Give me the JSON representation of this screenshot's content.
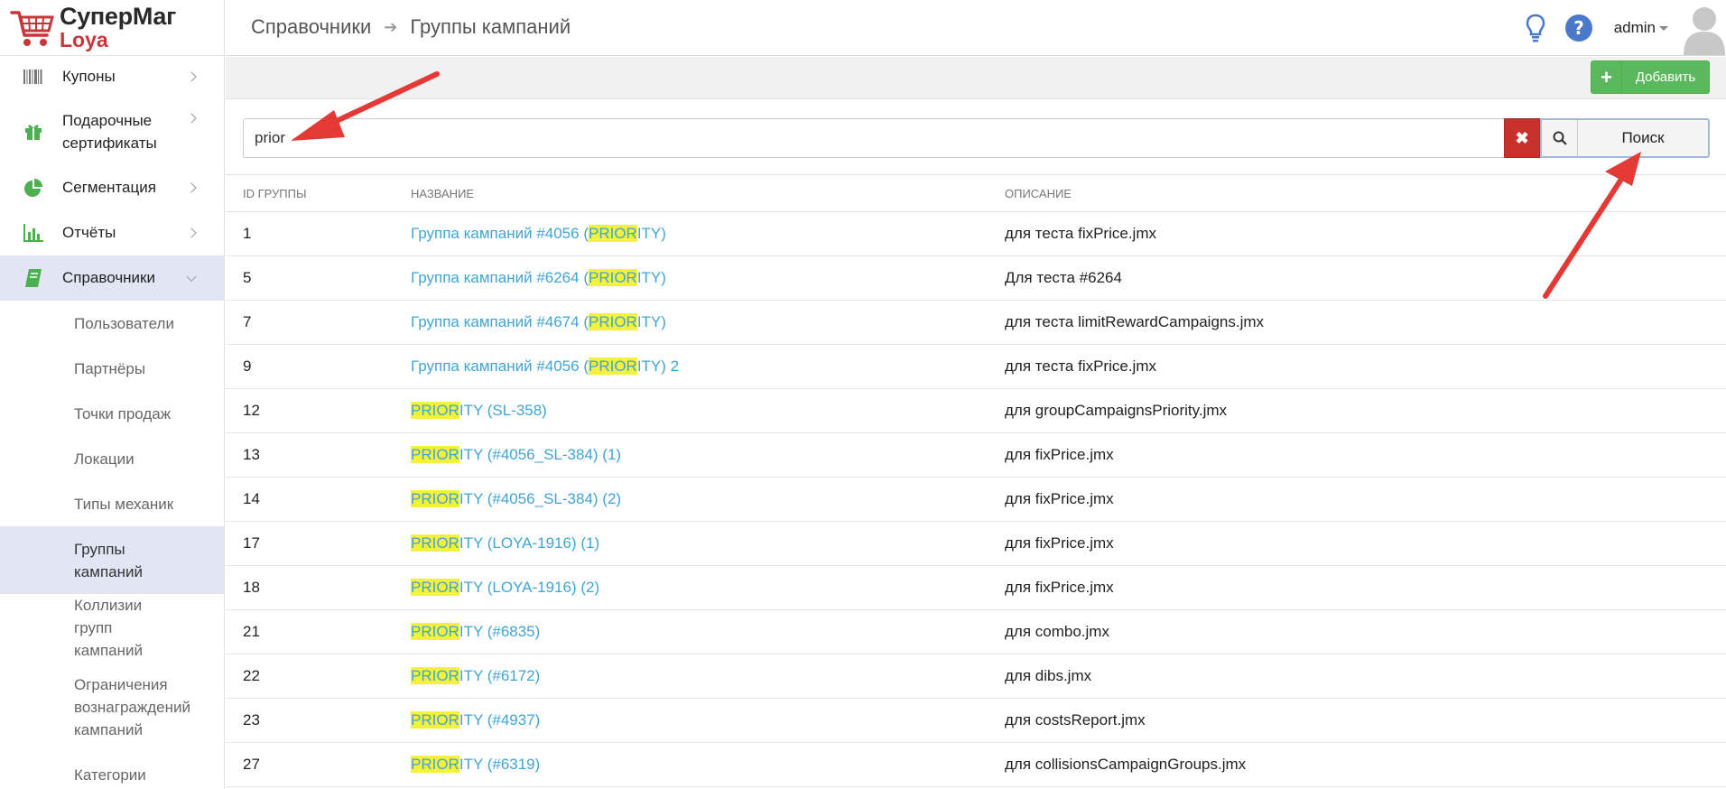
{
  "logo": {
    "line1": "СуперМаг",
    "line2": "Loya"
  },
  "colors": {
    "accent": "#3fa5d6",
    "brand_red": "#c8363a",
    "highlight": "#f5f23a",
    "add_green": "#5cb85c",
    "clear_red": "#c9302c",
    "active_bg": "#e2e6f4",
    "arrow_red": "#e53935"
  },
  "sidebar": {
    "items": [
      {
        "label": "Купоны",
        "icon": "barcode-icon"
      },
      {
        "label": "Подарочные\nсертификаты",
        "icon": "gift-icon"
      },
      {
        "label": "Сегментация",
        "icon": "pie-chart-icon"
      },
      {
        "label": "Отчёты",
        "icon": "bar-chart-icon"
      },
      {
        "label": "Справочники",
        "icon": "book-icon",
        "active": true
      }
    ],
    "subitems": [
      {
        "label": "Пользователи"
      },
      {
        "label": "Партнёры"
      },
      {
        "label": "Точки продаж"
      },
      {
        "label": "Локации"
      },
      {
        "label": "Типы механик"
      },
      {
        "label": "Группы кампаний",
        "active": true
      },
      {
        "label": "Коллизии групп кампаний"
      },
      {
        "label": "Ограничения вознаграждений кампаний"
      },
      {
        "label": "Категории"
      }
    ]
  },
  "breadcrumb": {
    "parent": "Справочники",
    "current": "Группы кампаний"
  },
  "user": {
    "name": "admin"
  },
  "toolbar": {
    "add_label": "Добавить"
  },
  "search": {
    "value": "prior",
    "button_label": "Поиск",
    "highlight": "PRIOR"
  },
  "table": {
    "columns": [
      "ID группы",
      "Название",
      "Описание"
    ],
    "rows": [
      {
        "id": "1",
        "name_pre": "Группа кампаний #4056 (",
        "name_hl": "PRIOR",
        "name_post": "ITY)",
        "desc": "для теста fixPrice.jmx"
      },
      {
        "id": "5",
        "name_pre": "Группа кампаний #6264 (",
        "name_hl": "PRIOR",
        "name_post": "ITY)",
        "desc": "Для теста #6264"
      },
      {
        "id": "7",
        "name_pre": "Группа кампаний #4674 (",
        "name_hl": "PRIOR",
        "name_post": "ITY)",
        "desc": "для теста limitRewardCampaigns.jmx"
      },
      {
        "id": "9",
        "name_pre": "Группа кампаний #4056 (",
        "name_hl": "PRIOR",
        "name_post": "ITY) 2",
        "desc": "для теста fixPrice.jmx"
      },
      {
        "id": "12",
        "name_pre": "",
        "name_hl": "PRIOR",
        "name_post": "ITY (SL-358)",
        "desc": "для groupCampaignsPriority.jmx"
      },
      {
        "id": "13",
        "name_pre": "",
        "name_hl": "PRIOR",
        "name_post": "ITY (#4056_SL-384) (1)",
        "desc": "для fixPrice.jmx"
      },
      {
        "id": "14",
        "name_pre": "",
        "name_hl": "PRIOR",
        "name_post": "ITY (#4056_SL-384) (2)",
        "desc": "для fixPrice.jmx"
      },
      {
        "id": "17",
        "name_pre": "",
        "name_hl": "PRIOR",
        "name_post": "ITY (LOYA-1916) (1)",
        "desc": "для fixPrice.jmx"
      },
      {
        "id": "18",
        "name_pre": "",
        "name_hl": "PRIOR",
        "name_post": "ITY (LOYA-1916) (2)",
        "desc": "для fixPrice.jmx"
      },
      {
        "id": "21",
        "name_pre": "",
        "name_hl": "PRIOR",
        "name_post": "ITY (#6835)",
        "desc": "для combo.jmx"
      },
      {
        "id": "22",
        "name_pre": "",
        "name_hl": "PRIOR",
        "name_post": "ITY (#6172)",
        "desc": "для dibs.jmx"
      },
      {
        "id": "23",
        "name_pre": "",
        "name_hl": "PRIOR",
        "name_post": "ITY (#4937)",
        "desc": "для costsReport.jmx"
      },
      {
        "id": "27",
        "name_pre": "",
        "name_hl": "PRIOR",
        "name_post": "ITY (#6319)",
        "desc": "для collisionsCampaignGroups.jmx"
      }
    ]
  }
}
